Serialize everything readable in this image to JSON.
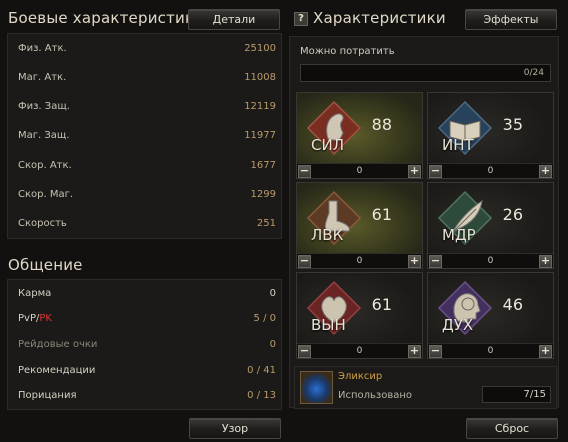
{
  "combat": {
    "title": "Боевые характеристики",
    "details_button": "Детали",
    "stats": [
      {
        "label": "Физ. Атк.",
        "value": "25100"
      },
      {
        "label": "Маг. Атк.",
        "value": "11008"
      },
      {
        "label": "Физ. Защ.",
        "value": "12119"
      },
      {
        "label": "Маг. Защ.",
        "value": "11977"
      },
      {
        "label": "Скор. Атк.",
        "value": "1677"
      },
      {
        "label": "Скор. Маг.",
        "value": "1299"
      },
      {
        "label": "Скорость",
        "value": "251"
      }
    ]
  },
  "social": {
    "title": "Общение",
    "karma_label": "Карма",
    "karma_value": "0",
    "pvp_label_a": "PvP/",
    "pvp_label_b": "PK",
    "pvp_value": "5 / 0",
    "raid_label": "Рейдовые очки",
    "raid_value": "0",
    "rec_label": "Рекомендации",
    "rec_value": "0 / 41",
    "blame_label": "Порицания",
    "blame_value": "0 / 13",
    "pattern_button": "Узор"
  },
  "attributes": {
    "title": "Характеристики",
    "effects_button": "Эффекты",
    "points_label": "Можно потратить",
    "points_value": "0/24",
    "items": [
      {
        "code": "СИЛ",
        "value": "88",
        "spent": "0",
        "icon": "arm-icon"
      },
      {
        "code": "ИНТ",
        "value": "35",
        "spent": "0",
        "icon": "book-icon"
      },
      {
        "code": "ЛВК",
        "value": "61",
        "spent": "0",
        "icon": "foot-icon"
      },
      {
        "code": "МДР",
        "value": "26",
        "spent": "0",
        "icon": "feather-icon"
      },
      {
        "code": "ВЫН",
        "value": "61",
        "spent": "0",
        "icon": "heart-icon"
      },
      {
        "code": "ДУХ",
        "value": "46",
        "spent": "0",
        "icon": "head-icon"
      }
    ],
    "elixir_name": "Эликсир",
    "elixir_sub": "Использовано",
    "elixir_count": "7/15",
    "reset_button": "Сброс"
  },
  "colors": {
    "accent": "#d29f45",
    "pk": "#d8332c",
    "active_card": "#4a4a22"
  }
}
